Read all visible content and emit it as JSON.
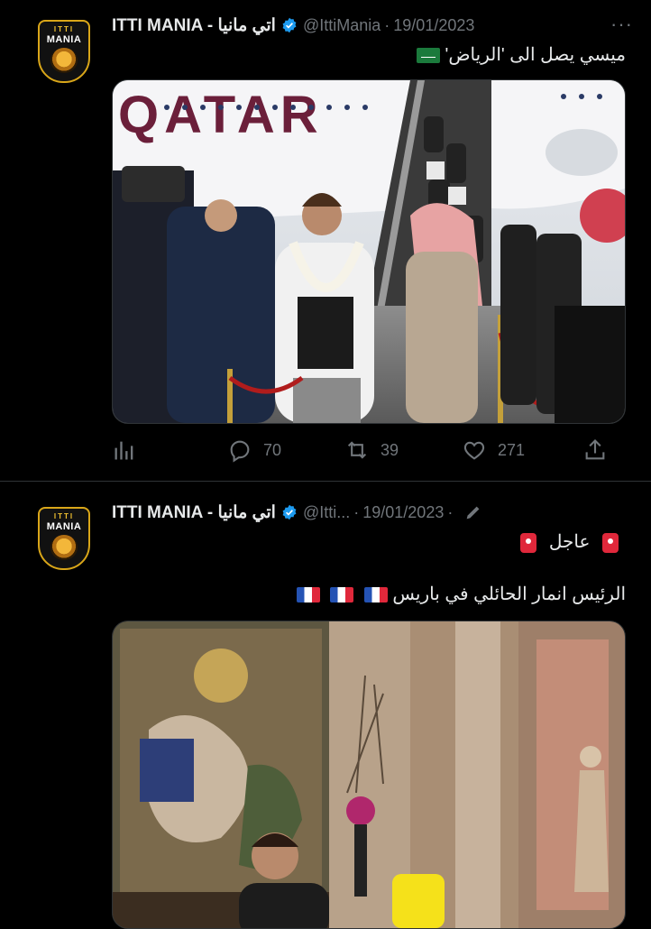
{
  "tweets": [
    {
      "author_name": "ITTI MANIA - اتي مانيا",
      "handle": "@IttiMania",
      "date": "19/01/2023",
      "text": "ميسي يصل الى 'الرياض'",
      "avatar": {
        "top": "ITTI",
        "brand": "MANIA"
      },
      "media_alt": "QATAR",
      "stats": {
        "replies": "70",
        "retweets": "39",
        "likes": "271"
      }
    },
    {
      "author_name": "ITTI MANIA - اتي مانيا",
      "handle": "@Itti...",
      "date": "19/01/2023",
      "urgent": "عاجل",
      "text": "الرئيس انمار الحائلي في باريس",
      "avatar": {
        "top": "ITTI",
        "brand": "MANIA"
      }
    }
  ],
  "colors": {
    "accent": "#1d9bf0",
    "muted": "#71767b",
    "background": "#000000"
  },
  "icons": [
    "verified-badge-icon",
    "more-icon",
    "views-icon",
    "reply-icon",
    "retweet-icon",
    "like-icon",
    "share-icon",
    "edit-icon",
    "saudi-flag-icon",
    "france-flag-icon",
    "siren-icon"
  ]
}
